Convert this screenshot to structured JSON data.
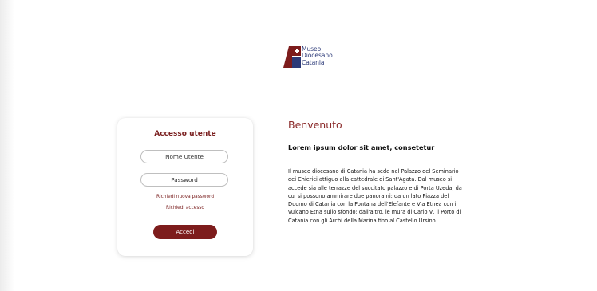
{
  "logo": {
    "line1": "Museo",
    "line2": "Diocesano",
    "line3": "Catania",
    "mark_color": "#7d1c1c",
    "text_color": "#2c3a78"
  },
  "login": {
    "title": "Accesso utente",
    "username_placeholder": "Nome Utente",
    "password_placeholder": "Password",
    "reset_link": "Richiedi nuova password",
    "request_access_link": "Richiedi accesso",
    "submit_label": "Accedi",
    "accent_color": "#7d1c1c"
  },
  "welcome": {
    "title": "Benvenuto",
    "subtitle": "Lorem ipsum dolor sit amet, consetetur",
    "body_lines": [
      "Il museo diocesano di Catania ha sede nel Palazzo del Seminario",
      "dei Chierici attiguo alla cattedrale di Sant'Agata. Dal museo si",
      "accede sia alle terrazze del succitato palazzo e di Porta Uzeda, da",
      "cui si possono ammirare due panorami: da un lato Piazza del",
      "Duomo di Catania con la Fontana dell'Elefante e Via Etnea con il",
      "vulcano Etna sullo sfondo; dall'altro, le mura di Carlo V, il Porto di",
      "Catania con gli Archi della Marina fino al Castello Ursino"
    ]
  }
}
